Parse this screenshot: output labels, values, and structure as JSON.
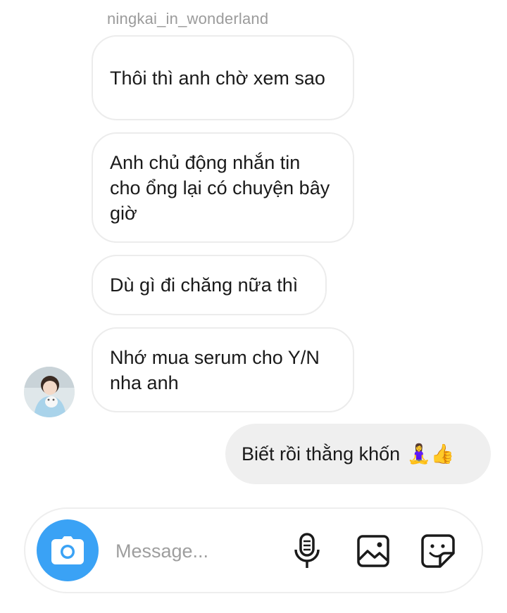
{
  "thread": {
    "sender_username": "ningkai_in_wonderland",
    "incoming_messages": [
      "Thôi thì anh chờ xem sao",
      "Anh chủ động nhắn tin cho ổng lại có chuyện bây giờ",
      "Dù gì đi chăng nữa thì",
      "Nhớ mua serum cho Y/N nha anh"
    ],
    "outgoing_messages": [
      {
        "text": "Biết rồi thằng khốn",
        "emoji": "🧘‍♀️👍"
      }
    ]
  },
  "composer": {
    "placeholder": "Message..."
  },
  "icons": {
    "camera": "camera-icon",
    "mic": "microphone-icon",
    "gallery": "gallery-icon",
    "sticker": "sticker-icon"
  },
  "colors": {
    "camera_button": "#3aa2f5",
    "outgoing_bubble": "#efefef",
    "incoming_border": "#ececec",
    "username": "#9b9b9b"
  }
}
